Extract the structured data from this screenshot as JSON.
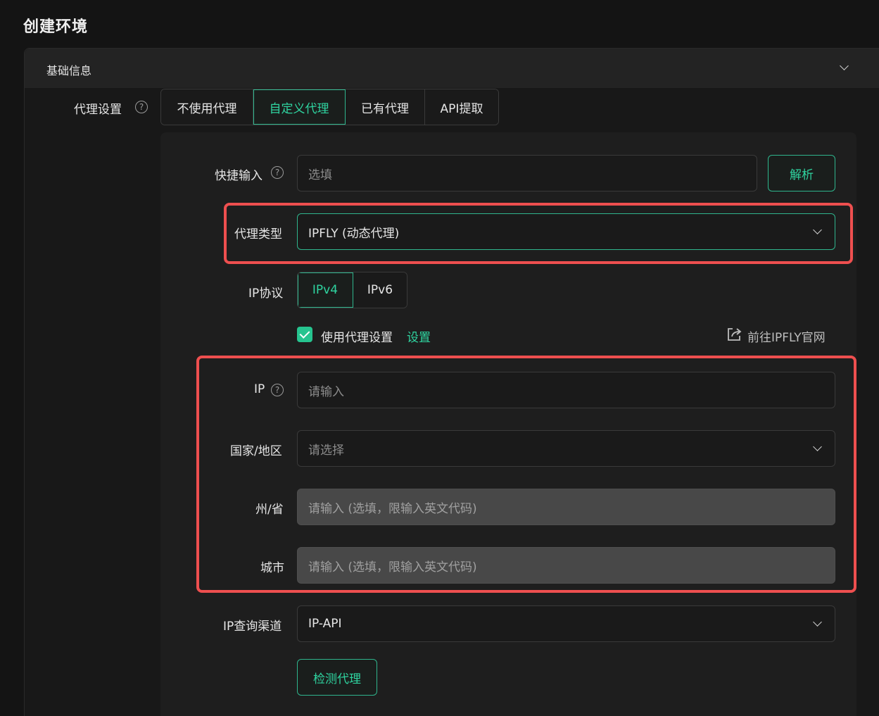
{
  "page": {
    "title": "创建环境"
  },
  "section": {
    "title": "基础信息"
  },
  "proxy_settings": {
    "label": "代理设置",
    "tabs": [
      "不使用代理",
      "自定义代理",
      "已有代理",
      "API提取"
    ],
    "active_tab": "自定义代理"
  },
  "quick_input": {
    "label": "快捷输入",
    "placeholder": "选填",
    "parse_button": "解析"
  },
  "proxy_type": {
    "label": "代理类型",
    "value": "IPFLY (动态代理)"
  },
  "ip_protocol": {
    "label": "IP协议",
    "options": [
      "IPv4",
      "IPv6"
    ],
    "selected": "IPv4"
  },
  "use_proxy": {
    "checked": true,
    "label": "使用代理设置",
    "settings_link": "设置",
    "external_link": "前往IPFLY官网"
  },
  "ip": {
    "label": "IP",
    "placeholder": "请输入"
  },
  "country": {
    "label": "国家/地区",
    "placeholder": "请选择"
  },
  "state": {
    "label": "州/省",
    "placeholder": "请输入 (选填，限输入英文代码)"
  },
  "city": {
    "label": "城市",
    "placeholder": "请输入 (选填，限输入英文代码)"
  },
  "ip_channel": {
    "label": "IP查询渠道",
    "value": "IP-API"
  },
  "check_button": {
    "label": "检测代理"
  },
  "colors": {
    "accent": "#2fd4a0",
    "highlight": "#ee4f4f",
    "background": "#141414"
  }
}
